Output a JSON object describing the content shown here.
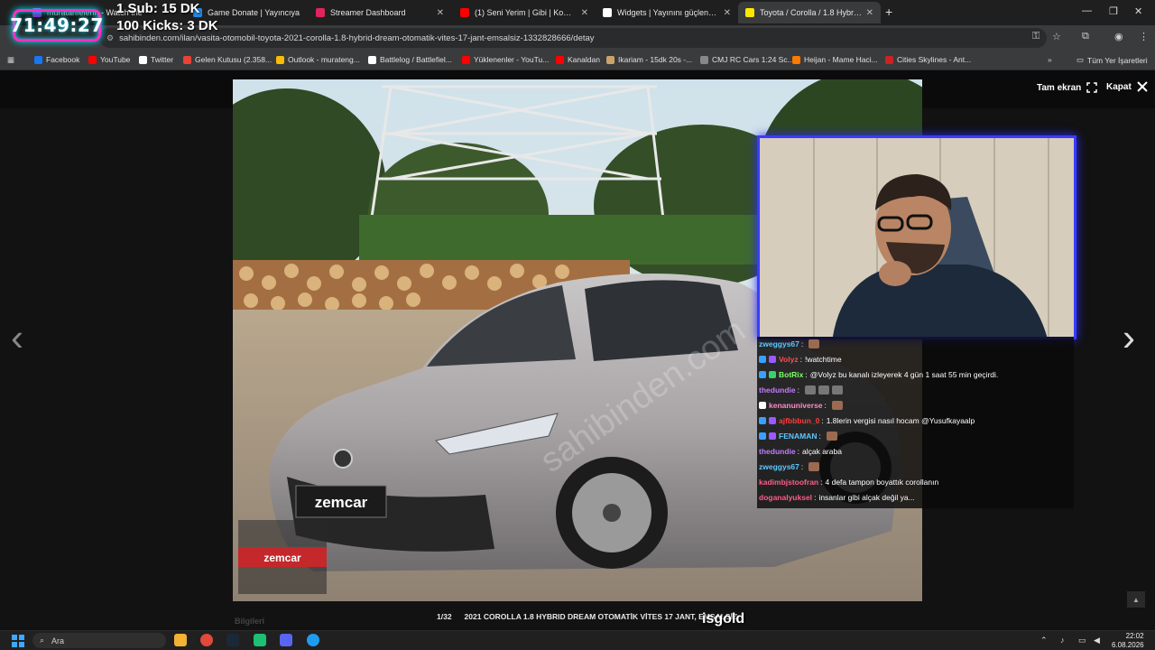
{
  "browser": {
    "tabs": [
      {
        "title": "muratarifelerin - Watch the",
        "favicon_color": "#9146ff",
        "active": false
      },
      {
        "title": "Game Donate | Yayıncıya",
        "favicon_color": "#1e88e5",
        "active": false
      },
      {
        "title": "Streamer Dashboard",
        "favicon_color": "#e0245e",
        "active": false
      },
      {
        "title": "(1) Seni Yerim | Gibi | Komik sah",
        "favicon_color": "#ff0000",
        "active": false
      },
      {
        "title": "Widgets | Yayınını güçlendirme",
        "favicon_color": "#ffffff",
        "active": false
      },
      {
        "title": "Toyota / Corolla / 1.8 Hybrid / D",
        "favicon_color": "#ffe800",
        "active": true
      }
    ],
    "new_tab": "+",
    "url": "sahibinden.com/ilan/vasita-otomobil-toyota-2021-corolla-1.8-hybrid-dream-otomatik-vites-17-jant-emsalsiz-1332828666/detay",
    "bookmarks": [
      {
        "label": "Facebook",
        "color": "#1877f2"
      },
      {
        "label": "YouTube",
        "color": "#ff0000"
      },
      {
        "label": "Twitter",
        "color": "#ffffff"
      },
      {
        "label": "Gelen Kutusu (2.358...",
        "color": "#ea4335"
      },
      {
        "label": "Outlook - murateng...",
        "color": "#fbbc05"
      },
      {
        "label": "Battlelog / Battlefiel...",
        "color": "#ffffff"
      },
      {
        "label": "Yüklenenler - YouTu...",
        "color": "#ff0000"
      },
      {
        "label": "Kanaldan",
        "color": "#ff0000"
      },
      {
        "label": "Ikariam - 15dk 20s -...",
        "color": "#c9a36b"
      },
      {
        "label": "CMJ RC Cars 1:24 Sc...",
        "color": "#888888"
      },
      {
        "label": "Heijan - Mame Haci...",
        "color": "#ff7a00"
      },
      {
        "label": "Cities Skylines - Ant...",
        "color": "#cc2222"
      }
    ],
    "all_bookmarks": "Tüm Yer İşaretleri"
  },
  "overlay": {
    "timer": "71:49:27",
    "goal_line1": "1 Sub: 15 DK",
    "goal_line2": "100 Kicks: 3 DK",
    "bottom_name": "isgold"
  },
  "viewer": {
    "fullscreen_label": "Tam ekran",
    "close_label": "Kapat",
    "counter": "1/32",
    "caption": "2021 COROLLA 1.8 HYBRID DREAM OTOMATİK VİTES 17 JANT, EMSALSİZ",
    "plate_text": "zemcar",
    "watermark": "sahibinden.com",
    "sign_text": "zemcar",
    "bottom_label": "Bilgileri"
  },
  "chat": [
    {
      "user": "zweggys67",
      "color": "#5cc8ff",
      "text": "",
      "emote": true,
      "badges": []
    },
    {
      "user": "Volyz",
      "color": "#ff4d4d",
      "text": "!watchtime",
      "emote": false,
      "badges": [
        "#3aa0ff",
        "#9b59ff"
      ]
    },
    {
      "user": "BotRix",
      "color": "#7dff6a",
      "text": "@Volyz bu kanalı izleyerek 4 gün 1 saat 55 min geçirdi.",
      "mention": "@Volyz",
      "emote": false,
      "badges": [
        "#3aa0ff",
        "#3ad16b"
      ]
    },
    {
      "user": "thedundie",
      "color": "#c07bff",
      "text": "",
      "emote": true,
      "badges": []
    },
    {
      "user": "kenanuniverse",
      "color": "#ff8ac8",
      "text": "",
      "emote": true,
      "badges": [
        "#ffffff"
      ]
    },
    {
      "user": "ajfbbbun_0",
      "color": "#ff3b3b",
      "text": "1.8lerin vergisi nasıl hocam @Yusufkayaalp",
      "mention": "@Yusufkayaalp",
      "emote": false,
      "badges": [
        "#3aa0ff",
        "#9b59ff"
      ]
    },
    {
      "user": "FENAMAN",
      "color": "#5cc8ff",
      "text": "",
      "emote": true,
      "badges": [
        "#3aa0ff",
        "#9b59ff"
      ]
    },
    {
      "user": "thedundie",
      "color": "#c07bff",
      "text": "alçak araba",
      "emote": false,
      "badges": []
    },
    {
      "user": "zweggys67",
      "color": "#5cc8ff",
      "text": "",
      "emote": true,
      "badges": []
    },
    {
      "user": "kadimbjstoofran",
      "color": "#ff5c8a",
      "text": "4 defa tampon boyattık corollanın",
      "emote": false,
      "badges": []
    },
    {
      "user": "doganalyuksel",
      "color": "#ff5c8a",
      "text": "insanlar gibi alçak değil ya...",
      "emote": false,
      "badges": []
    }
  ],
  "taskbar": {
    "search_placeholder": "Ara",
    "time": "22:02",
    "date": "6.08.2026"
  }
}
